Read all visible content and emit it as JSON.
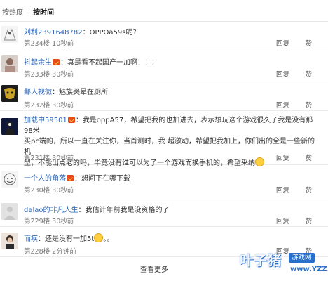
{
  "sort": {
    "hot": "按热度",
    "time": "按时间"
  },
  "actions": {
    "reply": "回复",
    "like": "赞"
  },
  "comments": [
    {
      "user": "刘利2391648782",
      "vip": false,
      "sep": "：",
      "text": "OPPOa59s呢？",
      "floor": "第234楼",
      "time": "10秒前"
    },
    {
      "user": "抖起余生",
      "vip": true,
      "sep": "：",
      "text": "真是看不起国产一加啊！！！",
      "floor": "第233楼",
      "time": "30秒前"
    },
    {
      "user": "鄙人视微",
      "vip": false,
      "sep": "：",
      "text": "魅族哭晕在厕所",
      "floor": "第232楼",
      "time": "30秒前"
    },
    {
      "user": "加载中59501",
      "vip": true,
      "sep": "：",
      "lines": [
        "我是oppA57，希望把我的也加进去，表示想玩这个游戏很久了我是没有那98米",
        "买pc端的，所以一直在关注你，当首测时，我 超激动，希望把我加上，你们出的全是一些新的机",
        "型，不能出点老的吗，毕竟没有谁可以为了一个游戏而换手机的，希望采纳"
      ],
      "floor": "第231楼",
      "time": "30秒前"
    },
    {
      "user": "一个人的角落",
      "vip": true,
      "sep": "：",
      "text": "想问下在哪下载",
      "floor": "第230楼",
      "time": "30秒前"
    },
    {
      "user": "dalao的非凡人生",
      "vip": false,
      "sep": "：",
      "text": "我估计年前我是没资格的了",
      "floor": "第229楼",
      "time": "30秒前"
    },
    {
      "user": "而疾",
      "vip": false,
      "sep": "：",
      "text": "还是没有一加5t",
      "tail": "。。",
      "floor": "第228楼",
      "time": "2分钟前"
    }
  ],
  "more": "查看更多",
  "watermark": {
    "brand": "叶子猪",
    "tag": "游戏网",
    "url": "www.YZZ.cn"
  },
  "colors": {
    "username": "#2d64b3",
    "vip_badge": "#e64a19",
    "watermark": "#2a6fc9"
  }
}
